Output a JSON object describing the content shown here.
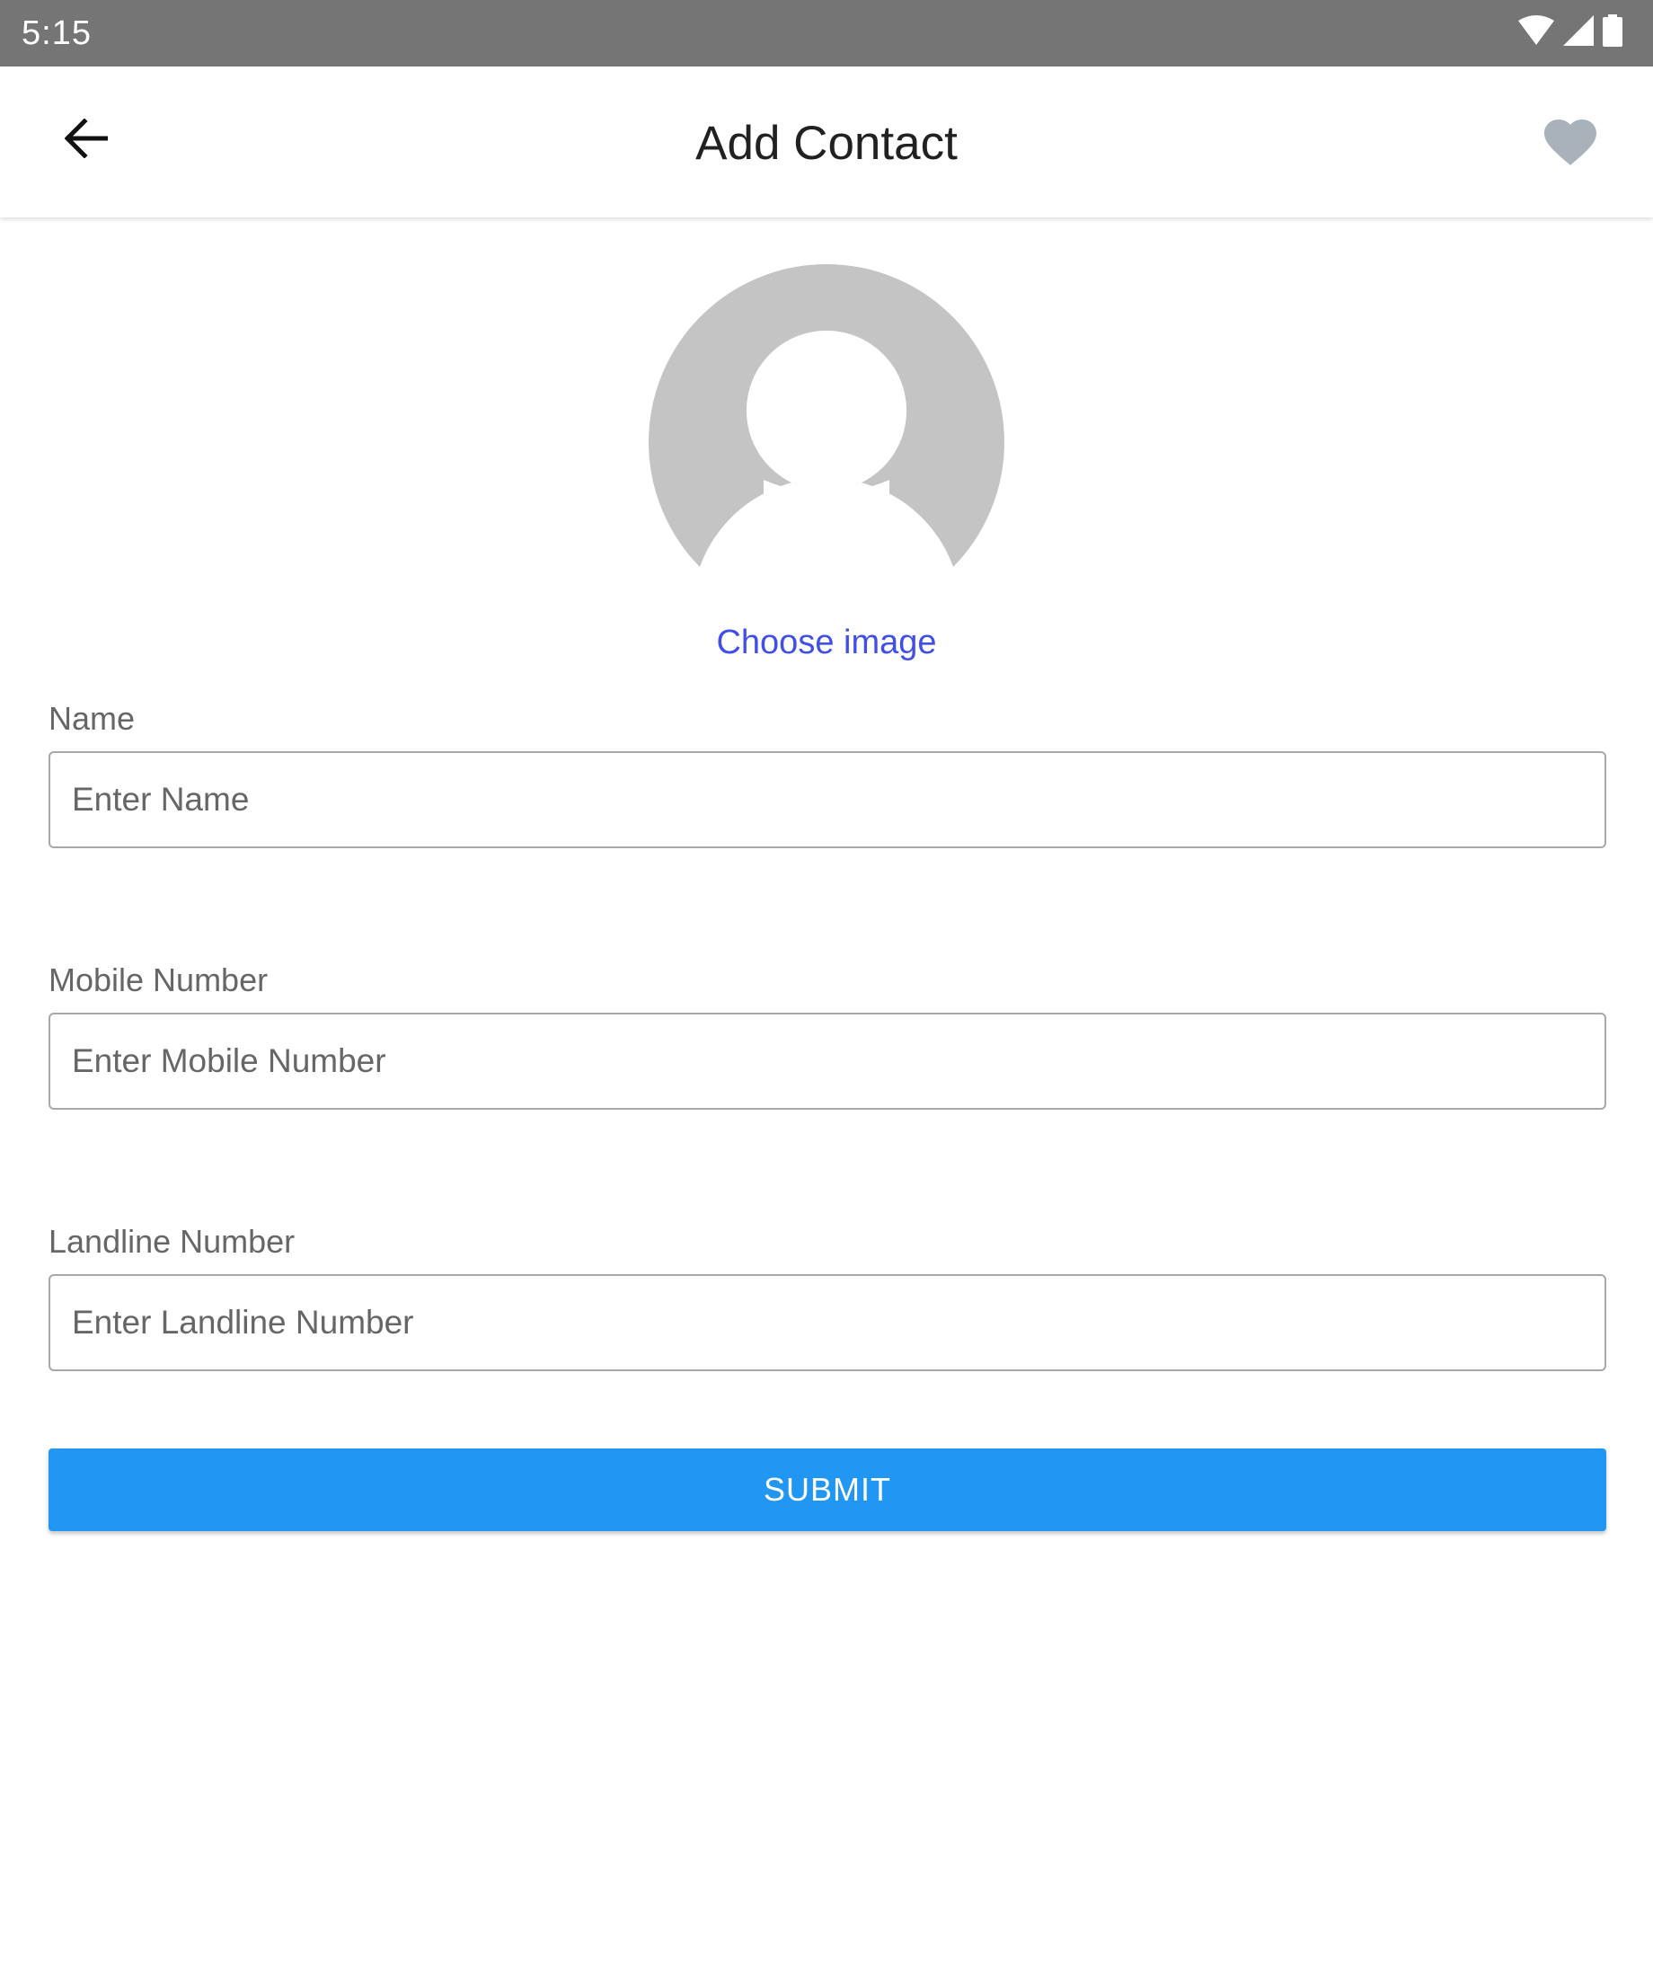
{
  "status_bar": {
    "time": "5:15",
    "icons": [
      "wifi-icon",
      "cell-signal-icon",
      "battery-icon"
    ]
  },
  "app_bar": {
    "title": "Add Contact",
    "back_icon": "arrow-back-icon",
    "favorite_icon": "heart-icon"
  },
  "avatar": {
    "icon": "person-placeholder-icon",
    "choose_label": "Choose image"
  },
  "form": {
    "name": {
      "label": "Name",
      "placeholder": "Enter Name",
      "value": ""
    },
    "mobile": {
      "label": "Mobile Number",
      "placeholder": "Enter Mobile Number",
      "value": ""
    },
    "landline": {
      "label": "Landline Number",
      "placeholder": "Enter Landline Number",
      "value": ""
    },
    "submit_label": "SUBMIT"
  },
  "colors": {
    "status_bar": "#757575",
    "accent": "#2196f3",
    "link": "#3f4fe8",
    "placeholder_avatar": "#c4c4c4",
    "heart": "#a9b2ba"
  }
}
